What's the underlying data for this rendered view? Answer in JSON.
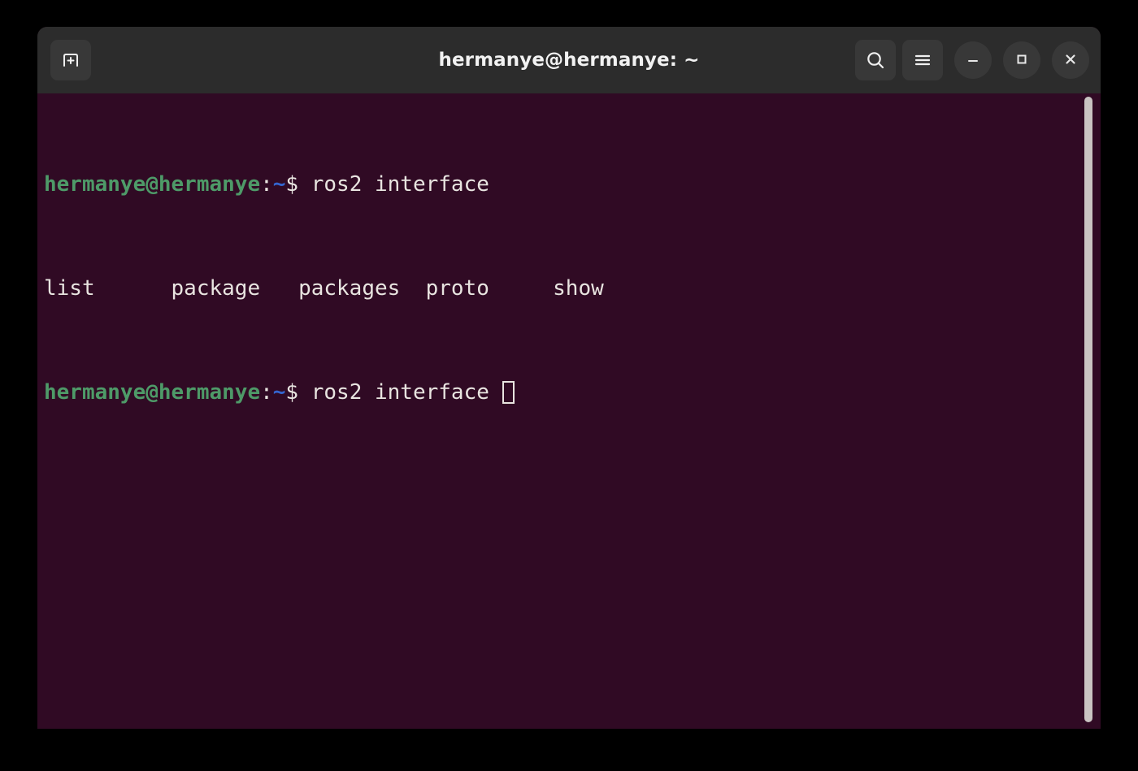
{
  "window": {
    "title": "hermanye@hermanye: ~",
    "header_bg": "#2c2c2c",
    "terminal_bg": "#300a24",
    "button_bg": "#383838"
  },
  "header": {
    "new_tab_label": "New Tab",
    "new_tab_icon": "new-tab-plus-icon",
    "search_label": "Search",
    "search_icon": "search-icon",
    "menu_label": "Main Menu",
    "menu_icon": "hamburger-menu-icon",
    "minimize_label": "Minimize",
    "minimize_icon": "minimize-icon",
    "maximize_label": "Maximize",
    "maximize_icon": "maximize-square-icon",
    "close_label": "Close",
    "close_icon": "close-x-icon"
  },
  "terminal": {
    "prompt_user_host": "hermanye@hermanye",
    "prompt_colon": ":",
    "prompt_path": "~",
    "prompt_sigil": "$ ",
    "colors": {
      "green": "#4e9a68",
      "blue": "#3465cf",
      "white": "#e8e4e0"
    },
    "line1_command": "ros2 interface",
    "completion_row": "list      package   packages  proto     show",
    "completions": [
      "list",
      "package",
      "packages",
      "proto",
      "show"
    ],
    "line3_command": "ros2 interface ",
    "cursor": "block-cursor"
  },
  "scrollbar": {
    "name": "vertical-scrollbar",
    "thumb_color": "#c9c4c2"
  }
}
